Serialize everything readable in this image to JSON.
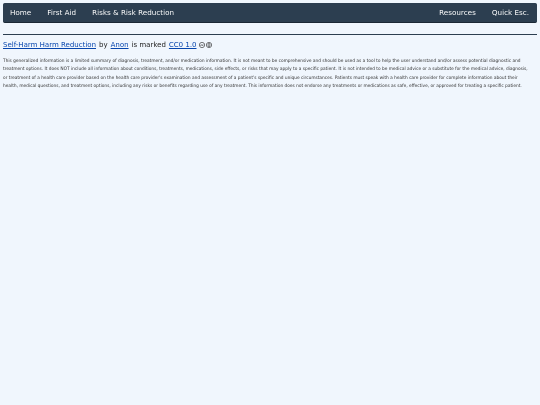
{
  "nav": {
    "left": [
      "Home",
      "First Aid",
      "Risks & Risk Reduction"
    ],
    "right": [
      "Resources",
      "Quick Esc."
    ]
  },
  "attribution": {
    "title": "Self-Harm Harm Reduction",
    "by": "by",
    "author": "Anon",
    "marked": "is marked",
    "license": "CC0 1.0",
    "icons": [
      "cc-icon",
      "zero-icon"
    ]
  },
  "disclaimer": "This generalized information is a limited summary of diagnosis, treatment, and/or medication information. It is not meant to be comprehensive and should be used as a tool to help the user understand and/or assess potential diagnostic and treatment options. It does NOT include all information about conditions, treatments, medications, side effects, or risks that may apply to a specific patient. It is not intended to be medical advice or a substitute for the medical advice, diagnosis, or treatment of a health care provider based on the health care provider's examination and assessment of a patient's specific and unique circumstances. Patients must speak with a health care provider for complete information about their health, medical questions, and treatment options, including any risks or benefits regarding use of any treatment. This information does not endorse any treatments or medications as safe, effective, or approved for treating a specific patient."
}
